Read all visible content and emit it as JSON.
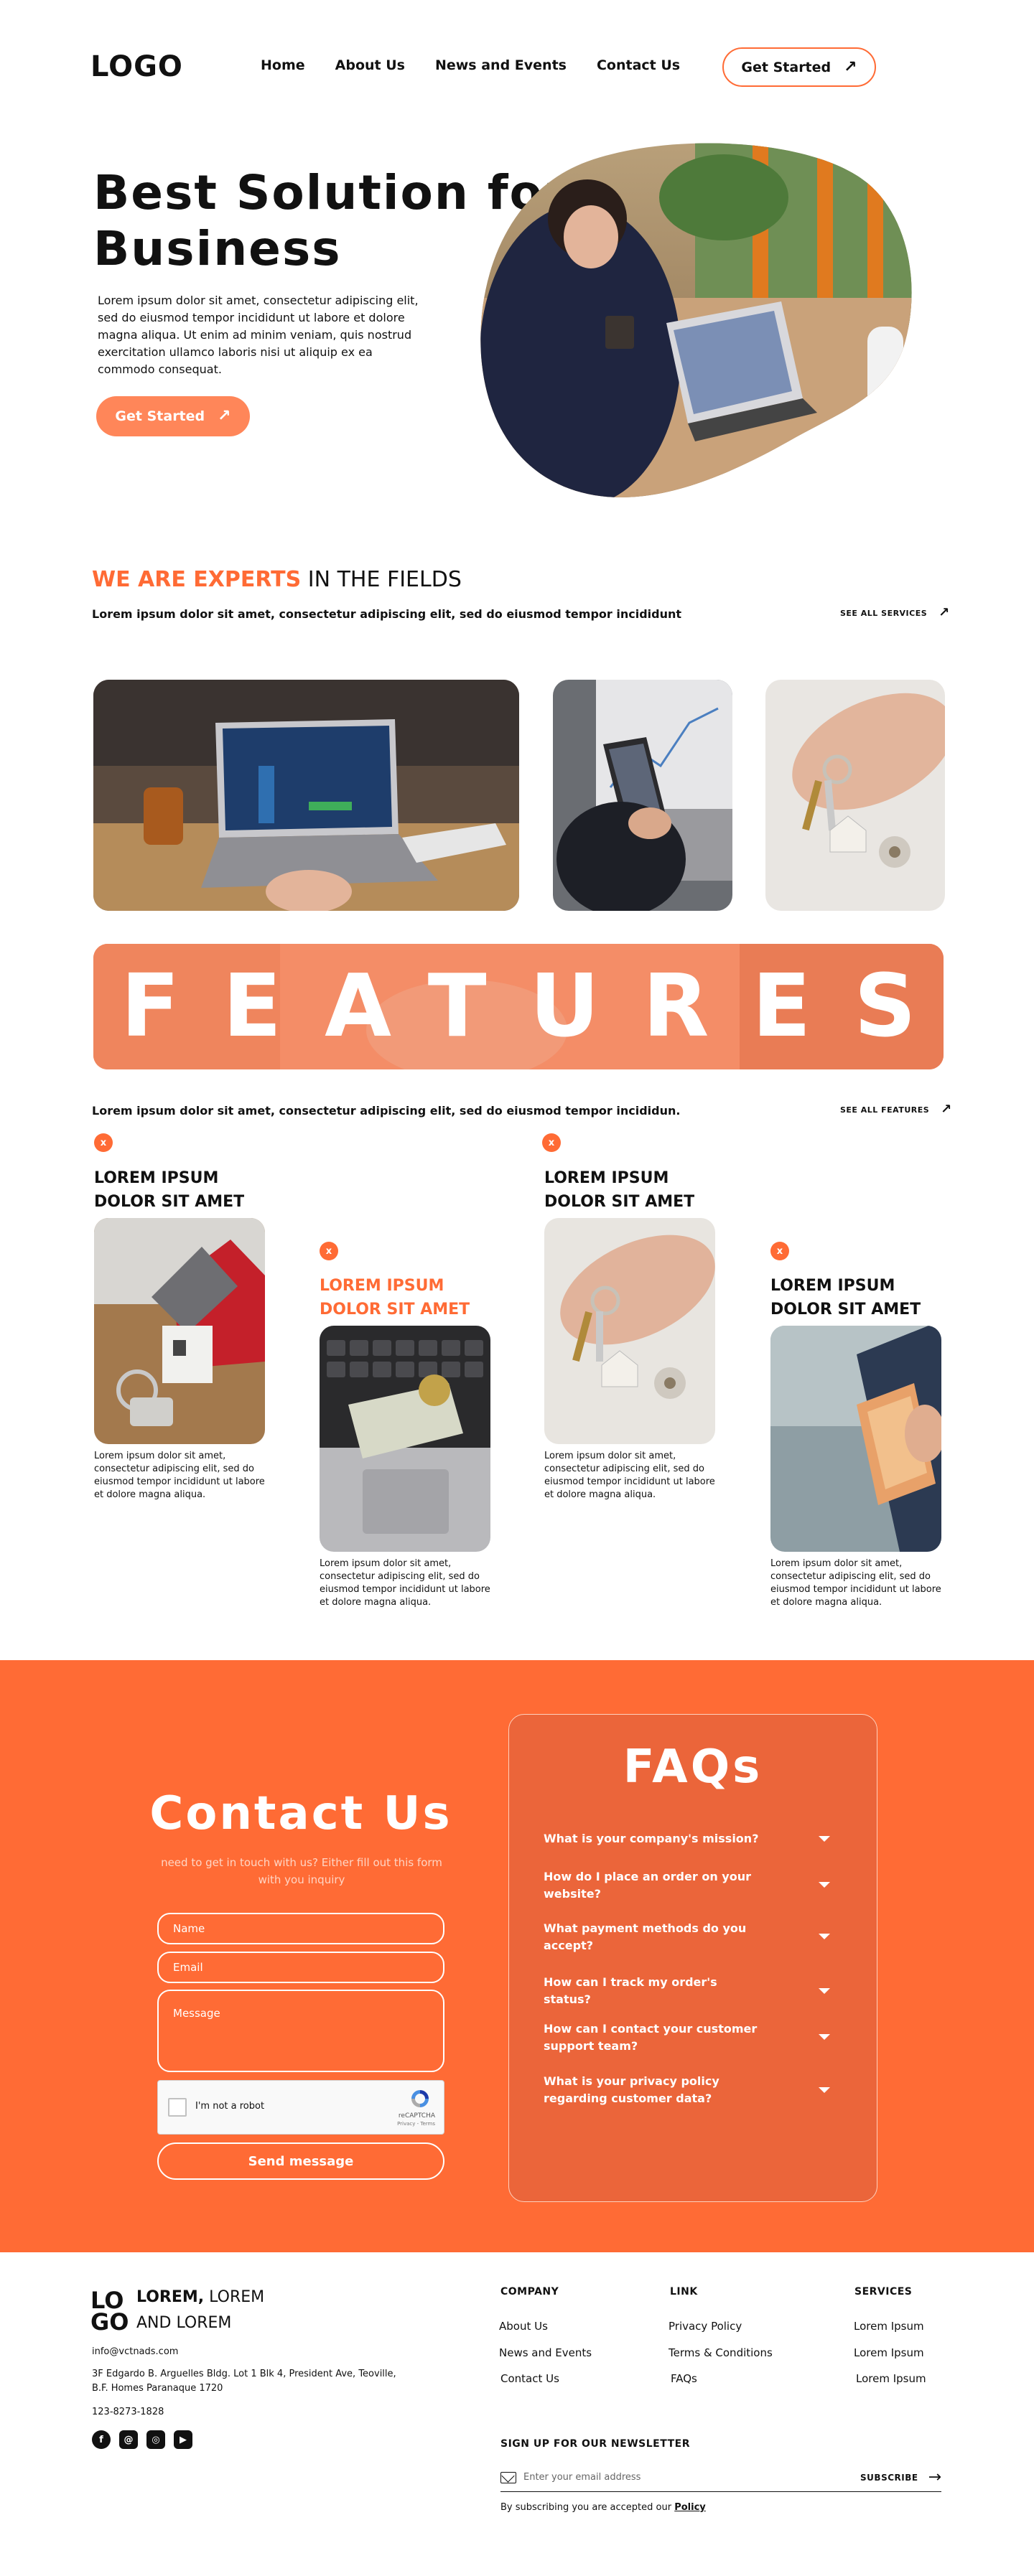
{
  "header": {
    "logo": "LOGO",
    "nav": [
      "Home",
      "About Us",
      "News and Events",
      "Contact Us"
    ],
    "cta_label": "Get Started"
  },
  "hero": {
    "title_line1": "Best Solution for",
    "title_line2": "Business",
    "text": "Lorem ipsum dolor sit amet, consectetur adipiscing elit, sed do eiusmod tempor incididunt ut labore et dolore magna aliqua. Ut enim ad minim veniam, quis nostrud exercitation ullamco laboris nisi ut aliquip ex ea commodo consequat.",
    "cta_label": "Get Started"
  },
  "experts": {
    "title_highlight": "WE ARE EXPERTS",
    "title_rest": " IN THE FIELDS",
    "subtitle": "Lorem ipsum dolor sit amet, consectetur adipiscing elit, sed do eiusmod tempor incididunt",
    "see_all": "SEE ALL SERVICES"
  },
  "features": {
    "banner": "FEATURES",
    "subtitle": "Lorem ipsum dolor sit amet, consectetur adipiscing elit, sed do eiusmod tempor incididun.",
    "see_all": "SEE ALL FEATURES",
    "badge": "x",
    "cards": [
      {
        "title_line1": "LOREM IPSUM",
        "title_line2": "DOLOR SIT AMET",
        "text": "Lorem ipsum dolor sit amet, consectetur adipiscing elit, sed do eiusmod tempor incididunt ut labore et dolore magna aliqua.",
        "highlight": false
      },
      {
        "title_line1": "LOREM IPSUM",
        "title_line2": "DOLOR SIT AMET",
        "text": "Lorem ipsum dolor sit amet, consectetur adipiscing elit, sed do eiusmod tempor incididunt ut labore et dolore magna aliqua.",
        "highlight": true
      },
      {
        "title_line1": "LOREM IPSUM",
        "title_line2": "DOLOR SIT AMET",
        "text": "Lorem ipsum dolor sit amet, consectetur adipiscing elit, sed do eiusmod tempor incididunt ut labore et dolore magna aliqua.",
        "highlight": false
      },
      {
        "title_line1": "LOREM IPSUM",
        "title_line2": "DOLOR SIT AMET",
        "text": "Lorem ipsum dolor sit amet, consectetur adipiscing elit, sed do eiusmod tempor incididunt ut labore et dolore magna aliqua.",
        "highlight": false
      }
    ]
  },
  "contact": {
    "title": "Contact Us",
    "subtitle": "need to get in touch with us? Either fill out this form with you inquiry",
    "name_placeholder": "Name",
    "email_placeholder": "Email",
    "message_placeholder": "Message",
    "captcha_label": "I'm not a robot",
    "captcha_brand": "reCAPTCHA",
    "captcha_links": "Privacy - Terms",
    "send_label": "Send message"
  },
  "faq": {
    "title": "FAQs",
    "questions": [
      "What is your company's mission?",
      "How do I place an order on your website?",
      "What payment methods do you accept?",
      "How can I track my order's status?",
      "How can I contact your customer support team?",
      "What is your privacy policy regarding customer data?"
    ]
  },
  "footer": {
    "logo_top": "LO",
    "logo_bottom": "GO",
    "brand_bold": "LOREM,",
    "brand_rest": " LOREM",
    "brand_line2": "AND LOREM",
    "email": "info@vctnads.com",
    "address_line1": "3F Edgardo B. Arguelles Bldg. Lot 1 Blk 4, President Ave, Teoville,",
    "address_line2": "B.F. Homes Paranaque 1720",
    "phone": "123-8273-1828",
    "columns": [
      {
        "heading": "COMPANY",
        "links": [
          "About Us",
          "News and Events",
          "Contact Us"
        ]
      },
      {
        "heading": "LINK",
        "links": [
          "Privacy Policy",
          "Terms & Conditions",
          "FAQs"
        ]
      },
      {
        "heading": "SERVICES",
        "links": [
          "Lorem Ipsum",
          "Lorem Ipsum",
          "Lorem Ipsum"
        ]
      }
    ],
    "newsletter_heading": "SIGN UP FOR OUR NEWSLETTER",
    "newsletter_placeholder": "Enter your email address",
    "subscribe_label": "SUBSCRIBE",
    "newsletter_note": "By subscribing you are accepted our ",
    "newsletter_policy": "Policy"
  },
  "colors": {
    "accent": "#ff6b35",
    "accent_soft": "#ff8659",
    "dark": "#111111"
  }
}
